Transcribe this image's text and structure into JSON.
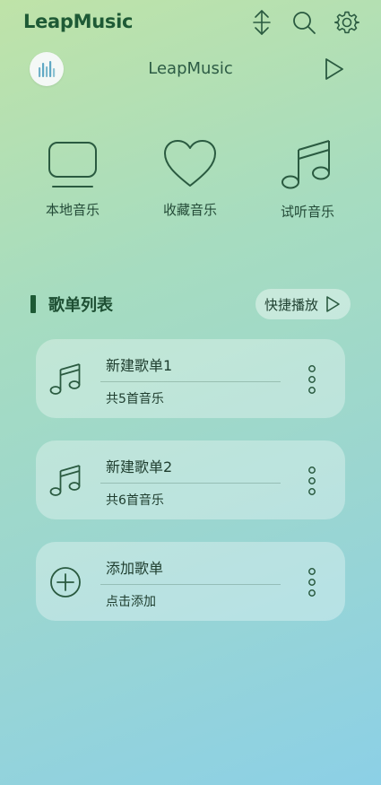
{
  "app": {
    "title": "LeapMusic"
  },
  "toolbar": {
    "icons": [
      "sort-icon",
      "search-icon",
      "settings-gear-icon"
    ]
  },
  "now_playing": {
    "title": "LeapMusic",
    "cover_icon": "equalizer-bars-icon",
    "play_icon": "play-icon"
  },
  "categories": [
    {
      "label": "本地音乐",
      "icon": "monitor-icon"
    },
    {
      "label": "收藏音乐",
      "icon": "heart-icon"
    },
    {
      "label": "试听音乐",
      "icon": "music-note-icon"
    }
  ],
  "playlist_section": {
    "title": "歌单列表",
    "quick_play_label": "快捷播放"
  },
  "playlists": [
    {
      "title": "新建歌单1",
      "subtitle": "共5首音乐",
      "icon": "music-note-icon"
    },
    {
      "title": "新建歌单2",
      "subtitle": "共6首音乐",
      "icon": "music-note-icon"
    },
    {
      "title": "添加歌单",
      "subtitle": "点击添加",
      "icon": "add-circle-icon"
    }
  ],
  "colors": {
    "accent": "#1e5a35",
    "text": "#234a37"
  }
}
